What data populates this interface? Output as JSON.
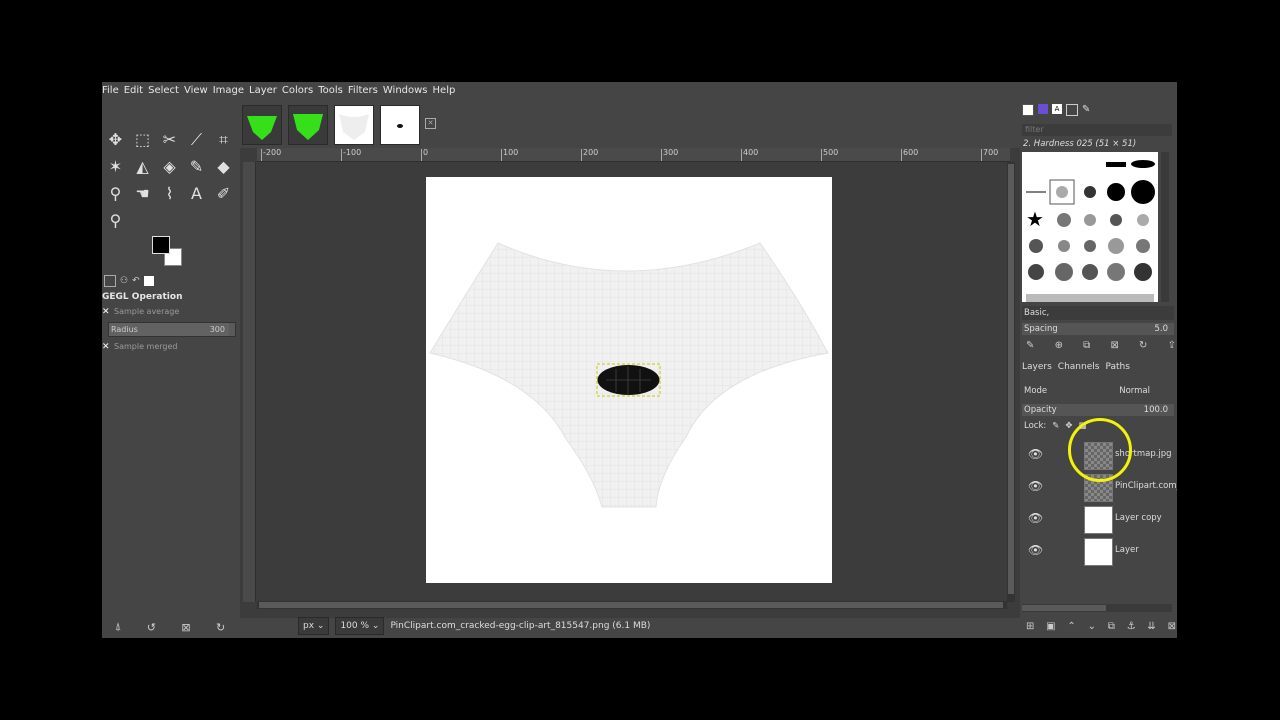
{
  "menu": [
    "File",
    "Edit",
    "Select",
    "View",
    "Image",
    "Layer",
    "Colors",
    "Tools",
    "Filters",
    "Windows",
    "Help"
  ],
  "tool_options": {
    "title": "GEGL Operation",
    "sample_average": "Sample average",
    "radius_label": "Radius",
    "radius_value": "300",
    "sample_merged": "Sample merged"
  },
  "ruler": {
    "labels": [
      "-200",
      "-100",
      "0",
      "100",
      "200",
      "300",
      "400",
      "500",
      "600",
      "700"
    ]
  },
  "status": {
    "unit": "px",
    "zoom": "100 %",
    "file": "PinClipart.com_cracked-egg-clip-art_815547.png (6.1 MB)"
  },
  "brushes": {
    "filter_placeholder": "filter",
    "selected": "2. Hardness 025 (51 × 51)",
    "set": "Basic,",
    "spacing_label": "Spacing",
    "spacing_value": "5.0"
  },
  "layers_panel": {
    "tabs": [
      "Layers",
      "Channels",
      "Paths"
    ],
    "mode_label": "Mode",
    "mode_value": "Normal",
    "opacity_label": "Opacity",
    "opacity_value": "100.0",
    "lock_label": "Lock:",
    "layers": [
      {
        "name": "shortmap.jpg"
      },
      {
        "name": "PinClipart.com_c"
      },
      {
        "name": "Layer copy"
      },
      {
        "name": "Layer"
      }
    ]
  },
  "colors": {
    "foreground": "#000000",
    "background": "#ffffff",
    "highlight": "#f2f20a"
  }
}
